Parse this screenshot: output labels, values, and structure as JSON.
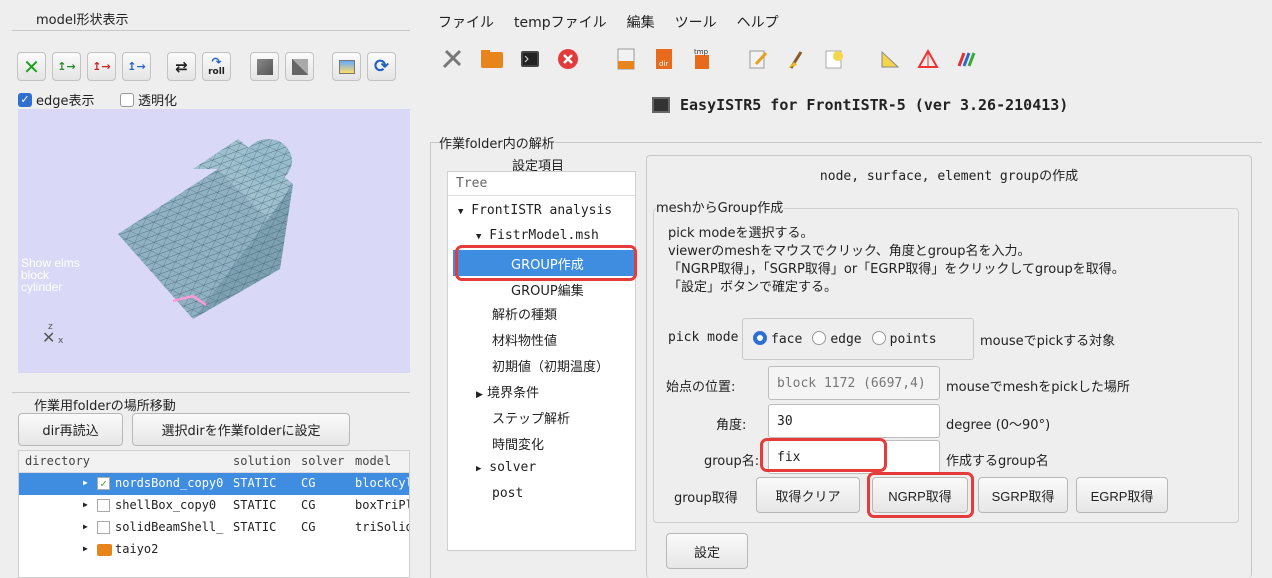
{
  "menu": [
    "ファイル",
    "tempファイル",
    "編集",
    "ツール",
    "ヘルプ"
  ],
  "app_title": "EasyISTR5 for FrontISTR-5  (ver 3.26-210413)",
  "left": {
    "model_group_label": "model形状表示",
    "model_buttons": [
      "x-axis-view",
      "y-axis-view",
      "z-axis-view",
      "reverse-view",
      "roll"
    ],
    "roll_label": "roll",
    "edge_checkbox": "edge表示",
    "transparent_checkbox": "透明化",
    "viewer_overlay": [
      "Show elms",
      "block",
      "cylinder"
    ],
    "axis_labels": {
      "z": "z",
      "x": "x"
    },
    "folder_group_label": "作業用folderの場所移動",
    "reload_button": "dir再読込",
    "set_folder_button": "選択dirを作業folderに設定",
    "table_headers": [
      "directory",
      "solution",
      "solver",
      "model"
    ],
    "table_rows": [
      {
        "name": "nordsBond_copy0",
        "solution": "STATIC",
        "solver": "CG",
        "model": "blockCyl",
        "checked": true,
        "selected": true
      },
      {
        "name": "shellBox_copy0",
        "solution": "STATIC",
        "solver": "CG",
        "model": "boxTriPl",
        "checked": false,
        "selected": false
      },
      {
        "name": "solidBeamShell_",
        "solution": "STATIC",
        "solver": "CG",
        "model": "triSolid",
        "checked": false,
        "selected": false
      },
      {
        "name": "taiyo2",
        "solution": "",
        "solver": "",
        "model": "",
        "folder": true
      }
    ]
  },
  "analysis": {
    "group_label": "作業folder内の解析",
    "settings_label": "設定項目",
    "tree_header": "Tree",
    "tree": {
      "root": "FrontISTR analysis",
      "mesh": "FistrModel.msh",
      "group_create": "GROUP作成",
      "group_edit": "GROUP編集",
      "items": [
        "解析の種類",
        "材料物性値",
        "初期値（初期温度）"
      ],
      "bc": "境界条件",
      "items2": [
        "ステップ解析",
        "時間変化"
      ],
      "solver": "solver",
      "post": "post"
    }
  },
  "panel": {
    "title": "node, surface, element groupの作成",
    "section": "meshからGroup作成",
    "instructions": [
      "pick modeを選択する。",
      "viewerのmeshをマウスでクリック、角度とgroup名を入力。",
      "「NGRP取得」，「SGRP取得」or「EGRP取得」をクリックしてgroupを取得。",
      "「設定」ボタンで確定する。"
    ],
    "pick_mode_label": "pick mode",
    "pick_options": [
      "face",
      "edge",
      "points"
    ],
    "pick_selected": "face",
    "pick_hint": "mouseでpickする対象",
    "start_label": "始点の位置:",
    "start_value": "block 1172 (6697,4)",
    "start_hint": "mouseでmeshをpickした場所",
    "angle_label": "角度:",
    "angle_value": "30",
    "angle_hint": "degree (0〜90°)",
    "group_name_label": "group名:",
    "group_name_value": "fix",
    "group_name_hint": "作成するgroup名",
    "get_label": "group取得",
    "clear_button": "取得クリア",
    "ngrp_button": "NGRP取得",
    "sgrp_button": "SGRP取得",
    "egrp_button": "EGRP取得",
    "set_button": "設定"
  },
  "colors": {
    "selection": "#3f8de0",
    "highlight_box": "#e53b3b",
    "viewer_bg": "#d9d9f7",
    "mesh": "#90b4c6"
  }
}
